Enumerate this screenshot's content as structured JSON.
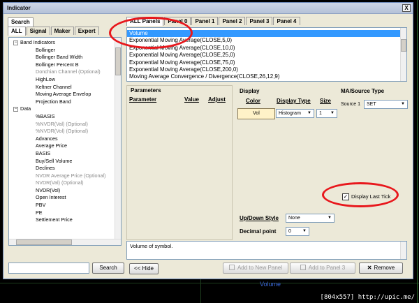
{
  "window": {
    "title": "Indicator",
    "close": "X"
  },
  "left": {
    "search_tab": "Search",
    "tabs": [
      "ALL",
      "Signal",
      "Maker",
      "Expert"
    ],
    "tree": [
      {
        "t": "Band Indicators",
        "lvl": 0,
        "exp": "−"
      },
      {
        "t": "Bollinger",
        "lvl": 1
      },
      {
        "t": "Bollinger Band Width",
        "lvl": 1
      },
      {
        "t": "Bollinger Percent B",
        "lvl": 1
      },
      {
        "t": "Donchian Channel (Optional)",
        "lvl": 1,
        "gray": true
      },
      {
        "t": "HighLow",
        "lvl": 1
      },
      {
        "t": "Keltner Channel",
        "lvl": 1
      },
      {
        "t": "Moving Average Envelop",
        "lvl": 1
      },
      {
        "t": "Projection Band",
        "lvl": 1
      },
      {
        "t": "Data",
        "lvl": 0,
        "exp": "−"
      },
      {
        "t": "%BASIS",
        "lvl": 1
      },
      {
        "t": "%NVDR(Val) (Optional)",
        "lvl": 1,
        "gray": true
      },
      {
        "t": "%NVDR(Vol) (Optional)",
        "lvl": 1,
        "gray": true
      },
      {
        "t": "Advances",
        "lvl": 1
      },
      {
        "t": "Average Price",
        "lvl": 1
      },
      {
        "t": "BASIS",
        "lvl": 1
      },
      {
        "t": "Buy/Sell Volume",
        "lvl": 1
      },
      {
        "t": "Declines",
        "lvl": 1
      },
      {
        "t": "NVDR Average Price (Optional)",
        "lvl": 1,
        "gray": true
      },
      {
        "t": "NVDR(Val) (Optional)",
        "lvl": 1,
        "gray": true
      },
      {
        "t": "NVDR(Vol)",
        "lvl": 1
      },
      {
        "t": "Open Interest",
        "lvl": 1
      },
      {
        "t": "PBV",
        "lvl": 1
      },
      {
        "t": "PE",
        "lvl": 1
      },
      {
        "t": "Settlement Price",
        "lvl": 1
      }
    ],
    "search_value": "",
    "search_button": "Search"
  },
  "panels": {
    "tabs": [
      "ALL Panels",
      "Panel 0",
      "Panel 1",
      "Panel 2",
      "Panel 3",
      "Panel 4"
    ],
    "items": [
      "Volume",
      "Exponential Moving Average(CLOSE,5,0)",
      "Exponential Moving Average(CLOSE,10,0)",
      "Exponential Moving Average(CLOSE,25,0)",
      "Exponential Moving Average(CLOSE,75,0)",
      "Exponential Moving Average(CLOSE,200,0)",
      "Moving Average Convergence / Divergence(CLOSE,26,12,9)"
    ]
  },
  "params": {
    "title": "Parameters",
    "headers": [
      "Parameter",
      "Value",
      "Adjust"
    ]
  },
  "display": {
    "title": "Display",
    "color_header": "Color",
    "type_header": "Display Type",
    "size_header": "Size",
    "color_value": "Vol",
    "color_hex": "#fff2c8",
    "type_value": "Histogram",
    "size_value": "1",
    "last_tick_label": "Display Last Tick",
    "last_tick_checked": true,
    "updown_label": "Up/Down Style",
    "updown_value": "None",
    "decimal_label": "Decimal point",
    "decimal_value": "0"
  },
  "ma": {
    "title": "MA/Source Type",
    "source_label": "Source 1",
    "source_value": "SET"
  },
  "description": "Volume of symbol.",
  "buttons": {
    "hide": "<< Hide",
    "add_new": "Add to New Panel",
    "add_to": "Add to Panel 3",
    "remove": "Remove"
  },
  "background": {
    "volume_label": "Volume",
    "stamp": "[804x557] http://upic.me/"
  }
}
